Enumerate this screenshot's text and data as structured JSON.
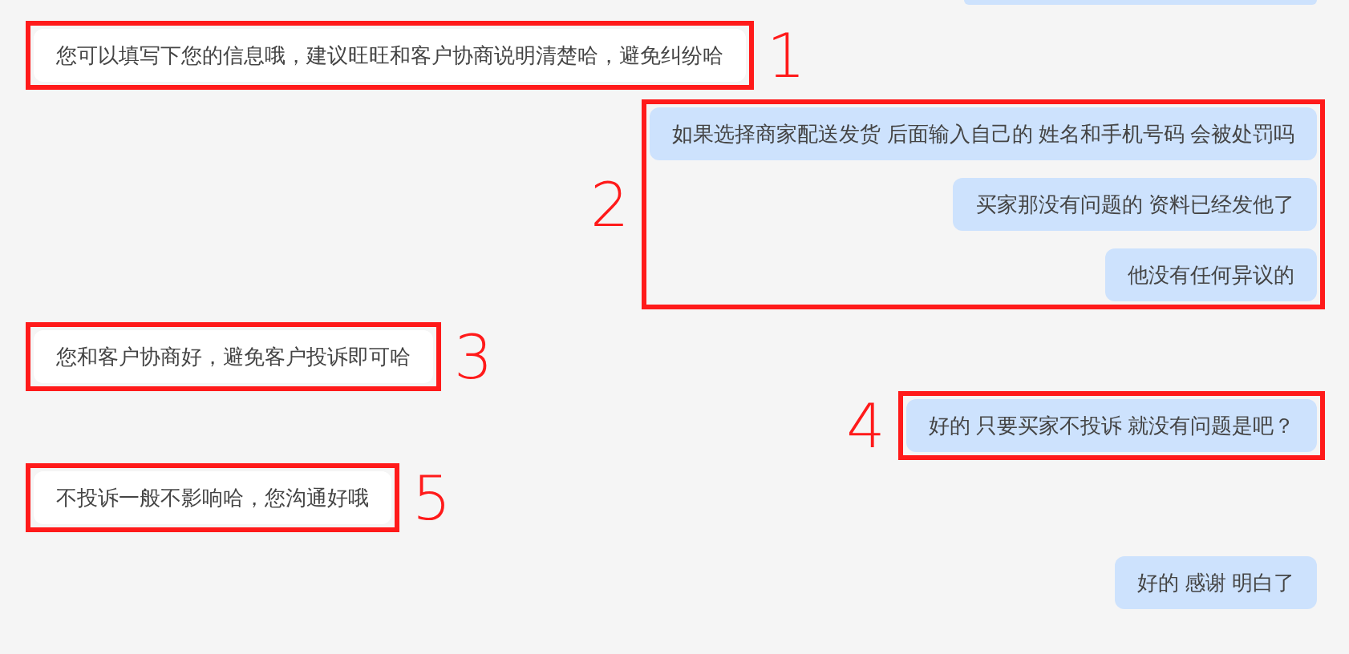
{
  "groups": [
    {
      "kind": "incoming",
      "annotation": "1",
      "messages": [
        {
          "text": "您可以填写下您的信息哦，建议旺旺和客户协商说明清楚哈，避免纠纷哈"
        }
      ]
    },
    {
      "kind": "outgoing",
      "annotation": "2",
      "messages": [
        {
          "text": "如果选择商家配送发货 后面输入自己的 姓名和手机号码 会被处罚吗"
        },
        {
          "text": "买家那没有问题的 资料已经发他了"
        },
        {
          "text": "他没有任何异议的"
        }
      ]
    },
    {
      "kind": "incoming",
      "annotation": "3",
      "messages": [
        {
          "text": "您和客户协商好，避免客户投诉即可哈"
        }
      ]
    },
    {
      "kind": "outgoing",
      "annotation": "4",
      "messages": [
        {
          "text": "好的 只要买家不投诉 就没有问题是吧？"
        }
      ]
    },
    {
      "kind": "incoming",
      "annotation": "5",
      "messages": [
        {
          "text": "不投诉一般不影响哈，您沟通好哦"
        }
      ]
    },
    {
      "kind": "outgoing",
      "messages": [
        {
          "text": "好的 感谢 明白了"
        }
      ]
    }
  ]
}
